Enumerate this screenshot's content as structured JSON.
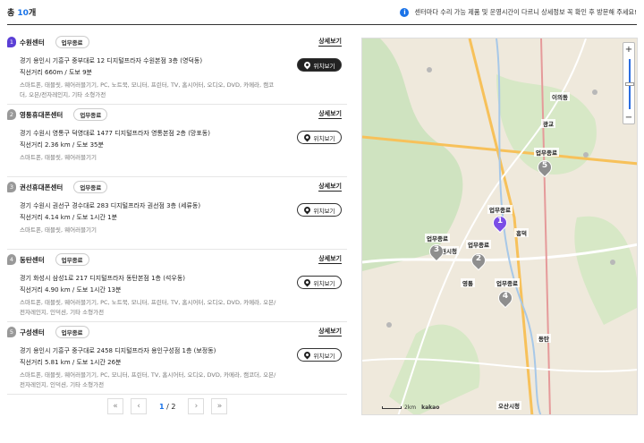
{
  "header": {
    "total_prefix": "총",
    "total_count": "10",
    "total_suffix": "개",
    "notice": "센터마다 수리 가능 제품 및 운영시간이 다르니 상세정보 꼭 확인 후 방문해 주세요!"
  },
  "centers": [
    {
      "num": "1",
      "name": "수원센터",
      "status": "업무종료",
      "detail": "상세보기",
      "address": "경기 용인시 기흥구 중부대로 12 디지털프라자 수원본점 3층 (영덕동)",
      "distance": "직선거리 660m / 도보 9분",
      "products": "스마트폰, 태블릿, 웨어러블기기, PC, 노트북, 모니터, 프린터, TV, 홈시어터, 오디오, DVD, 카메라, 캠코더, 오븐/전자레인지, 기타 소형가전",
      "location_btn": "위치보기"
    },
    {
      "num": "2",
      "name": "영통휴대폰센터",
      "status": "업무종료",
      "detail": "상세보기",
      "address": "경기 수원시 영통구 덕영대로 1477 디지털프라자 영통본점 2층 (망포동)",
      "distance": "직선거리 2.36 km / 도보 35분",
      "products": "스마트폰, 태블릿, 웨어러블기기",
      "location_btn": "위치보기"
    },
    {
      "num": "3",
      "name": "권선휴대폰센터",
      "status": "업무종료",
      "detail": "상세보기",
      "address": "경기 수원시 권선구 경수대로 283 디지털프라자 권선점 3층 (세류동)",
      "distance": "직선거리 4.14 km / 도보 1시간 1분",
      "products": "스마트폰, 태블릿, 웨어러블기기",
      "location_btn": "위치보기"
    },
    {
      "num": "4",
      "name": "동탄센터",
      "status": "업무종료",
      "detail": "상세보기",
      "address": "경기 화성시 삼성1로 217 디지털프라자 동탄본점 1층 (석우동)",
      "distance": "직선거리 4.90 km / 도보 1시간 13분",
      "products": "스마트폰, 태블릿, 웨어러블기기, PC, 노트북, 모니터, 프린터, TV, 홈시어터, 오디오, DVD, 카메라, 오븐/전자레인지, 인덕션, 기타 소형가전",
      "location_btn": "위치보기"
    },
    {
      "num": "5",
      "name": "구성센터",
      "status": "업무종료",
      "detail": "상세보기",
      "address": "경기 용인시 기흥구 중구대로 2458 디지털프라자 용인구성점 1층 (보정동)",
      "distance": "직선거리 5.81 km / 도보 1시간 26분",
      "products": "스마트폰, 태블릿, 웨어러블기기, PC, 모니터, 프린터, TV, 홈시어터, 오디오, DVD, 카메라, 캠코더, 오븐/전자레인지, 인덕션, 기타 소형가전",
      "location_btn": "위치보기"
    }
  ],
  "pagination": {
    "first": "«",
    "prev": "‹",
    "current": "1",
    "separator": " / ",
    "total": "2",
    "next": "›",
    "last": "»"
  },
  "map": {
    "zoom_in": "+",
    "zoom_out": "−",
    "markers": [
      {
        "num": "1",
        "label": "업무종료",
        "active": true
      },
      {
        "num": "2",
        "label": "업무종료",
        "active": false
      },
      {
        "num": "3",
        "label": "업무종료",
        "active": false
      },
      {
        "num": "4",
        "label": "업무종료",
        "active": false
      },
      {
        "num": "5",
        "label": "업무종료",
        "active": false
      }
    ],
    "place_labels": [
      "수원시청",
      "흥덕",
      "광교",
      "이의동",
      "오산시청",
      "영통",
      "동탄"
    ],
    "scale": "2km",
    "logo": "kakao"
  },
  "colors": {
    "accent": "#1a73e8",
    "active_marker": "#7b4ee6",
    "inactive_marker": "#8e8e8e"
  }
}
